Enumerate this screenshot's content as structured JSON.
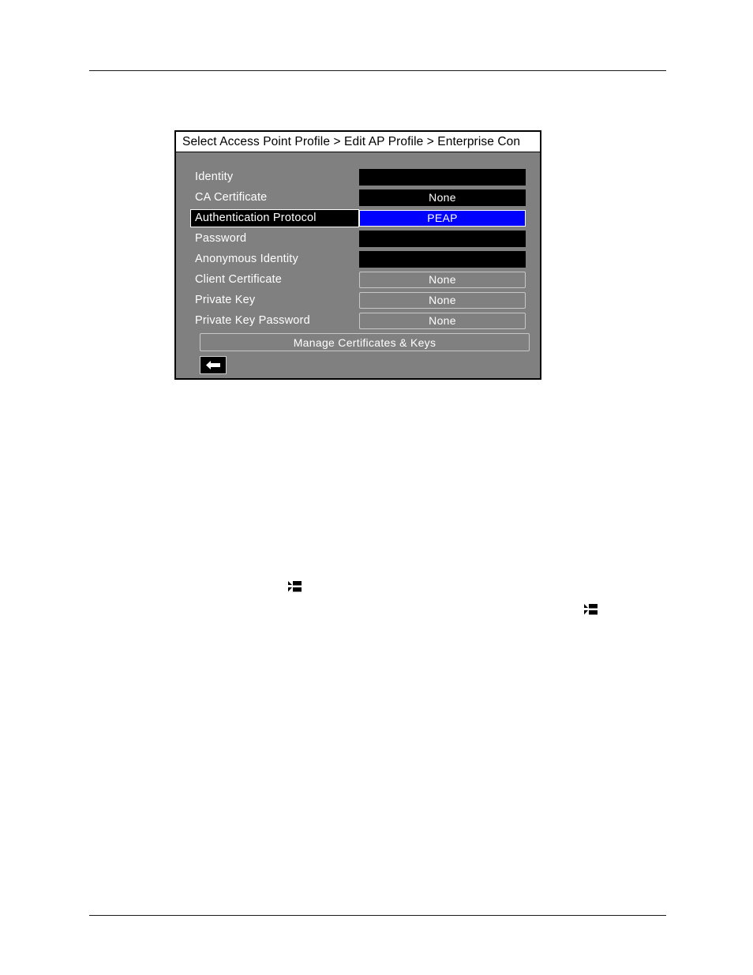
{
  "document": {
    "background_color": "#ffffff",
    "rule_color": "#1a1a1a"
  },
  "device_screen": {
    "title": "Select Access Point Profile > Edit AP Profile > Enterprise Con",
    "colors": {
      "screen_background": "#808080",
      "titlebar_background": "#ffffff",
      "titlebar_text": "#000000",
      "label_text": "#ffffff",
      "field_background": "#000000",
      "field_text": "#ffffff",
      "selected_background": "#0000ff",
      "selected_border": "#ffffff",
      "disabled_border": "#c8c8c8",
      "border": "#000000"
    },
    "rows": [
      {
        "label": "Identity",
        "value": "",
        "state": "editable",
        "selected": false
      },
      {
        "label": "CA Certificate",
        "value": "None",
        "state": "editable",
        "selected": false
      },
      {
        "label": "Authentication Protocol",
        "value": "PEAP",
        "state": "selected",
        "selected": true
      },
      {
        "label": "Password",
        "value": "",
        "state": "editable",
        "selected": false
      },
      {
        "label": "Anonymous Identity",
        "value": "",
        "state": "editable",
        "selected": false
      },
      {
        "label": "Client Certificate",
        "value": "None",
        "state": "disabled",
        "selected": false
      },
      {
        "label": "Private Key",
        "value": "None",
        "state": "disabled",
        "selected": false
      },
      {
        "label": "Private Key Password",
        "value": "None",
        "state": "disabled",
        "selected": false
      }
    ],
    "manage_button_label": "Manage Certificates & Keys",
    "back_button": {
      "icon": "left-arrow-icon",
      "label": ""
    }
  },
  "inline_glyphs": [
    {
      "icon": "back-arrow-glyph-icon"
    },
    {
      "icon": "back-arrow-glyph-icon"
    }
  ]
}
